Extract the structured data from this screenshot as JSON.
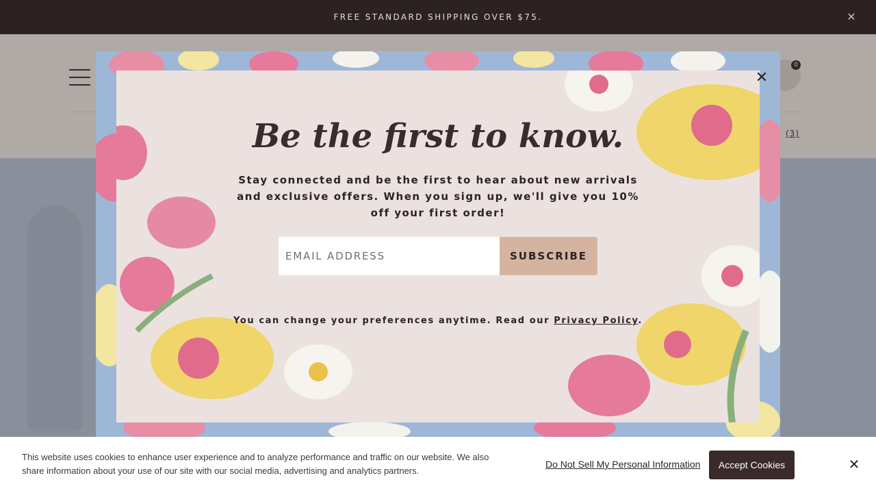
{
  "topbar": {
    "text": "FREE STANDARD SHIPPING OVER $75.",
    "close_icon": "close-icon"
  },
  "header": {
    "cart_count": "0",
    "wishlist_count": "(3)",
    "menu_icon": "hamburger-icon",
    "cart_icon": "shopping-bag-icon"
  },
  "modal": {
    "title": "Be the first to know.",
    "body": "Stay connected and be the first to hear about new arrivals and exclusive offers. When you sign up, we'll give you 10% off your first order!",
    "email_placeholder": "EMAIL ADDRESS",
    "subscribe_label": "SUBSCRIBE",
    "preferences_prefix": "You can change your preferences anytime. Read our ",
    "privacy_link": "Privacy Policy",
    "preferences_suffix": ".",
    "close_icon": "close-icon"
  },
  "cookie": {
    "text": "This website uses cookies to enhance user experience and to analyze performance and traffic on our website. We also share information about your use of our site with our social media, advertising and analytics partners.",
    "do_not_sell": "Do Not Sell My Personal Information",
    "accept_label": "Accept Cookies",
    "close_icon": "close-icon"
  },
  "colors": {
    "topbar_bg": "#2c2223",
    "modal_panel": "#ebe2df",
    "subscribe_bg": "#d5b49f",
    "accept_bg": "#3a2a2a"
  }
}
